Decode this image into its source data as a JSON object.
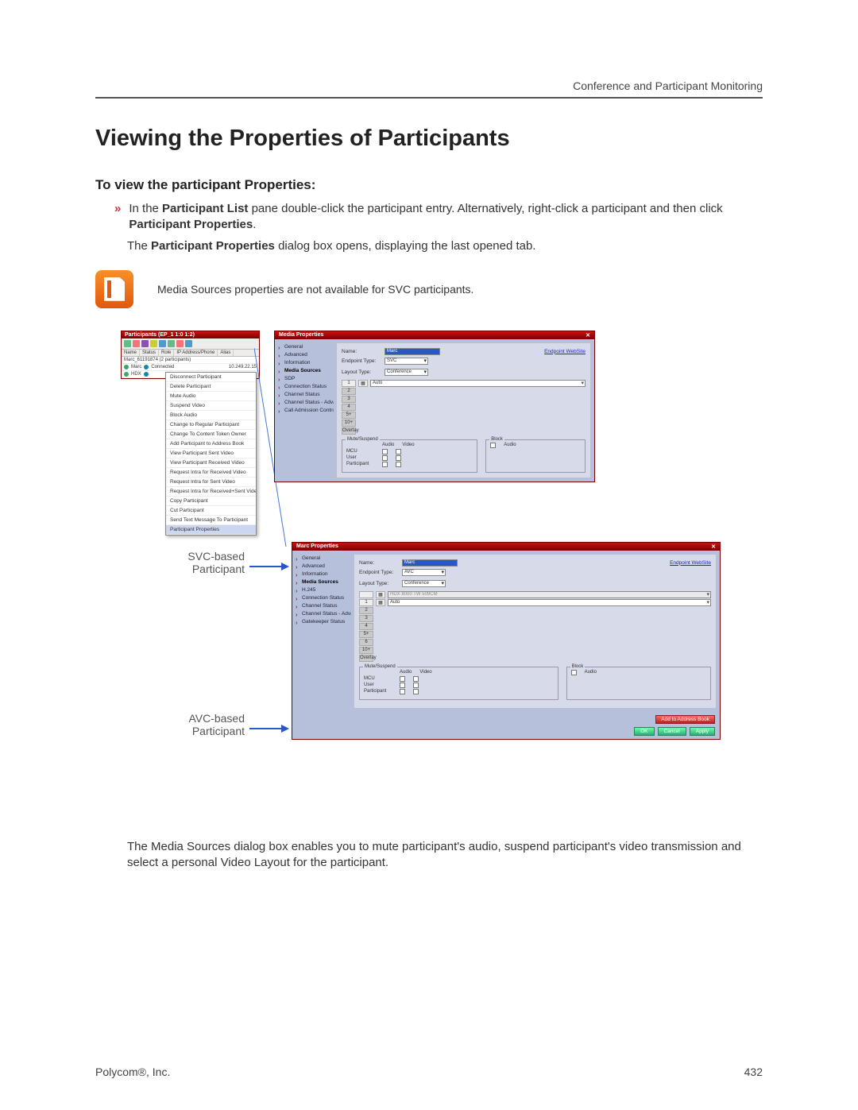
{
  "header": {
    "right": "Conference and Participant Monitoring"
  },
  "headings": {
    "h1": "Viewing the Properties of Participants",
    "h2": "To view the participant Properties:"
  },
  "bullet": {
    "prefix": "In the ",
    "b1": "Participant List",
    "mid1": " pane double-click the participant entry. Alternatively, right-click a participant and then click ",
    "b2": "Participant Properties",
    "suffix": "."
  },
  "line2": {
    "pre": "The ",
    "b": "Participant Properties",
    "post": " dialog box opens, displaying the last opened tab."
  },
  "note": "Media Sources properties are not available for SVC participants.",
  "participants_pane": {
    "title": "Participants (EP_1 1:0 1:2)",
    "cols": [
      "Name",
      "Status",
      "Role",
      "IP Address/Phone",
      "Alias"
    ],
    "group": "Marc_61191874 (2 participants)",
    "rows": [
      {
        "name": "Marc",
        "status": "Connected",
        "ip": "10.249.22.15"
      },
      {
        "name": "HDX",
        "status": "",
        "ip": ""
      }
    ],
    "context_menu": [
      "Disconnect Participant",
      "Delete Participant",
      "Mute Audio",
      "Suspend Video",
      "Block Audio",
      "Change to Regular Participant",
      "Change To Content Token Owner",
      "Add Participant to Address Book",
      "View Participant Sent Video",
      "View Participant Received Video",
      "Request Intra for Received Video",
      "Request Intra for Sent Video",
      "Request Intra for Received+Sent Video",
      "Copy Participant",
      "Cut Participant",
      "Send Text Message To Participant",
      "Participant Properties"
    ]
  },
  "dialog_svc": {
    "title": "Media Properties",
    "sidenav": [
      "General",
      "Advanced",
      "Information",
      "Media Sources",
      "SDP",
      "Connection Status",
      "Channel Status",
      "Channel Status - Adva...",
      "Call Admission Control"
    ],
    "sidenav_selected": "Media Sources",
    "name_label": "Name:",
    "name_value": "Marc",
    "endpoint_label": "Endpoint Type:",
    "endpoint_value": "SVC",
    "layout_label": "Layout Type:",
    "layout_value": "Conference",
    "link": "Endpoint WebSite",
    "slot_nums": [
      "1",
      "2",
      "3",
      "4",
      "5+",
      "10+",
      "Overlay"
    ],
    "slot_value": "Auto",
    "grp_mute": {
      "title": "Mute/Suspend",
      "cols": [
        "Audio",
        "Video"
      ],
      "rows": [
        "MCU",
        "User",
        "Participant"
      ]
    },
    "grp_block": {
      "title": "Block",
      "row": "Audio"
    }
  },
  "dialog_avc": {
    "title": "Marc Properties",
    "sidenav": [
      "General",
      "Advanced",
      "Information",
      "Media Sources",
      "H.245",
      "Connection Status",
      "Channel Status",
      "Channel Status - Adva...",
      "Gatekeeper Status"
    ],
    "sidenav_selected": "Media Sources",
    "name_label": "Name:",
    "name_value": "Marc",
    "endpoint_label": "Endpoint Type:",
    "endpoint_value": "AVC",
    "layout_label": "Layout Type:",
    "layout_value": "Conference",
    "link": "Endpoint WebSite",
    "slot_nums": [
      "1",
      "2",
      "3",
      "4",
      "5+",
      "6",
      "10+",
      "Overlay"
    ],
    "slot_caption1": "HDX 8000 TW 509CM",
    "slot_value": "Auto",
    "grp_mute": {
      "title": "Mute/Suspend",
      "cols": [
        "Audio",
        "Video"
      ],
      "rows": [
        "MCU",
        "User",
        "Participant"
      ]
    },
    "grp_block": {
      "title": "Block",
      "row": "Audio"
    },
    "buttons": {
      "add": "Add to Address Book",
      "ok": "OK",
      "cancel": "Cancel",
      "apply": "Apply"
    }
  },
  "callouts": {
    "svc": "SVC-based\nParticipant",
    "avc": "AVC-based\nParticipant"
  },
  "after_para": "The Media Sources dialog box enables you to mute participant's audio, suspend participant's video transmission and select a personal Video Layout for the participant.",
  "footer": {
    "left": "Polycom®, Inc.",
    "right": "432"
  }
}
